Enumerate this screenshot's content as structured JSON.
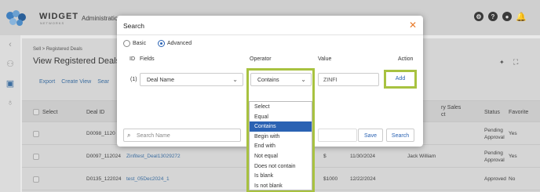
{
  "app": {
    "brand": "WIDGET",
    "brand_sub": "NETWORKS",
    "section": "Administratio"
  },
  "top_icons": [
    "settings-icon",
    "help-icon",
    "user-icon",
    "bell-icon"
  ],
  "page": {
    "breadcrumb": "Sell  >  Registered Deals",
    "title": "View Registered Deals"
  },
  "toolbar": {
    "export": "Export",
    "create_view": "Create View",
    "search": "Sear"
  },
  "table": {
    "headers": {
      "select": "Select",
      "deal_id": "Deal ID",
      "sales": "ry Sales",
      "sales2": "ct",
      "status": "Status",
      "favorite": "Favorite"
    },
    "rows": [
      {
        "id": "D0098_1120",
        "name": "",
        "amount": "",
        "date": "",
        "rep": "",
        "status": "Pending",
        "status2": "Approval",
        "fav": "Yes"
      },
      {
        "id": "D0097_112024",
        "name": "Zinfitest_Deal13029272",
        "amount": "$",
        "date": "11/30/2024",
        "rep": "Jack William",
        "status": "Pending",
        "status2": "Approval",
        "fav": "Yes"
      },
      {
        "id": "D0135_122024",
        "name": "test_05Dec2024_1",
        "amount": "$1000",
        "date": "12/22/2024",
        "rep": "",
        "status": "Approved",
        "status2": "",
        "fav": "No"
      }
    ]
  },
  "modal": {
    "title": "Search",
    "close": "✕",
    "mode_basic": "Basic",
    "mode_advanced": "Advanced",
    "selected_mode": "Advanced",
    "col_id": "ID",
    "col_fields": "Fields",
    "col_operator": "Operator",
    "col_value": "Value",
    "col_action": "Action",
    "row_index": "(1)",
    "field_value": "Deal Name",
    "operator_value": "Contains",
    "value_text": "ZINFI",
    "add_label": "Add",
    "operator_options": [
      "Select",
      "Equal",
      "Contains",
      "Begin with",
      "End with",
      "Not equal",
      "Does not contain",
      "Is blank",
      "Is not blank"
    ],
    "selected_option": "Contains",
    "search_name_placeholder": "Search Name",
    "save_label": "Save",
    "search_label": "Search"
  },
  "colors": {
    "highlight": "#a8c240",
    "accent": "#2a62b3",
    "close": "#e87a2a"
  }
}
